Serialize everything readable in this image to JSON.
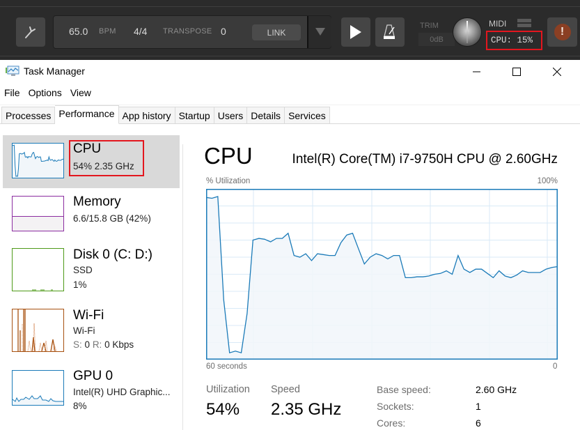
{
  "daw_toolbar": {
    "tempo_value": "65.0",
    "tempo_unit": "BPM",
    "time_signature": "4/4",
    "transpose_label": "TRANSPOSE",
    "transpose_value": "0",
    "link_label": "LINK",
    "trim_label": "TRIM",
    "trim_value": "0dB",
    "midi_label": "MIDI",
    "cpu_readout": "CPU:  15%",
    "icons": [
      "wrench-icon",
      "dropdown-arrow-icon",
      "play-icon",
      "metronome-icon",
      "knob-icon",
      "alert-icon"
    ],
    "highlight_color": "#e3161e"
  },
  "window": {
    "title": "Task Manager",
    "controls": {
      "minimize": "—",
      "maximize": "☐",
      "close": "✕"
    }
  },
  "menu": [
    "File",
    "Options",
    "View"
  ],
  "tabs": [
    {
      "label": "Processes",
      "active": false
    },
    {
      "label": "Performance",
      "active": true
    },
    {
      "label": "App history",
      "active": false
    },
    {
      "label": "Startup",
      "active": false
    },
    {
      "label": "Users",
      "active": false
    },
    {
      "label": "Details",
      "active": false
    },
    {
      "label": "Services",
      "active": false
    }
  ],
  "sidebar": {
    "items": [
      {
        "name": "CPU",
        "line1": "54%  2.35 GHz",
        "line2": "",
        "color": "#1a7ab8",
        "selected": true
      },
      {
        "name": "Memory",
        "line1": "6.6/15.8 GB (42%)",
        "line2": "",
        "color": "#8b2ca0",
        "selected": false
      },
      {
        "name": "Disk 0 (C: D:)",
        "line1": "SSD",
        "line2": "1%",
        "color": "#4e9a18",
        "selected": false
      },
      {
        "name": "Wi-Fi",
        "line1": "Wi-Fi",
        "line2_s": "S:",
        "line2_sv": "0",
        "line2_r": "R:",
        "line2_rv": "0 Kbps",
        "color": "#a7500f",
        "selected": false
      },
      {
        "name": "GPU 0",
        "line1": "Intel(R) UHD Graphic...",
        "line2": "8%",
        "color": "#1a7ab8",
        "selected": false
      }
    ],
    "memory_used_fraction": 0.42
  },
  "main": {
    "title": "CPU",
    "model": "Intel(R) Core(TM) i7-9750H CPU @ 2.60GHz",
    "y_label": "% Utilization",
    "y_max_label": "100%",
    "x_left_label": "60 seconds",
    "x_right_label": "0",
    "stats": {
      "utilization_label": "Utilization",
      "utilization_value": "54%",
      "speed_label": "Speed",
      "speed_value": "2.35 GHz"
    },
    "specs": [
      {
        "key": "Base speed:",
        "value": "2.60 GHz"
      },
      {
        "key": "Sockets:",
        "value": "1"
      },
      {
        "key": "Cores:",
        "value": "6"
      }
    ]
  },
  "chart_data": {
    "type": "area",
    "title": "CPU",
    "xlabel": "60 seconds",
    "ylabel": "% Utilization",
    "xlim": [
      60,
      0
    ],
    "ylim": [
      0,
      100
    ],
    "grid": true,
    "line_color": "#1a7ab8",
    "fill_color": "#f1f6fa",
    "x": [
      60,
      59,
      58,
      57,
      56,
      55,
      54,
      53,
      52,
      51,
      50,
      49,
      48,
      47,
      46,
      45,
      44,
      43,
      42,
      41,
      40,
      39,
      38,
      37,
      36,
      35,
      34,
      33,
      32,
      31,
      30,
      29,
      28,
      27,
      26,
      25,
      24,
      23,
      22,
      21,
      20,
      19,
      18,
      17,
      16,
      15,
      14,
      13,
      12,
      11,
      10,
      9,
      8,
      7,
      6,
      5,
      4,
      3,
      2,
      1,
      0
    ],
    "series": [
      {
        "name": "CPU utilization",
        "values": [
          95,
          94.5,
          95.5,
          35,
          4,
          5,
          4,
          27,
          70,
          71,
          70.5,
          69,
          71,
          71,
          74,
          61,
          60,
          62,
          58,
          62,
          61.5,
          61,
          61,
          68.5,
          73,
          74,
          65,
          56,
          60,
          62,
          61,
          59,
          61,
          61,
          48,
          48,
          48.5,
          48.5,
          49,
          50,
          50.5,
          52,
          50,
          61,
          53,
          51,
          53,
          53,
          50.5,
          48,
          52,
          49,
          48,
          49.5,
          52,
          51,
          51,
          51,
          53,
          54,
          54.5
        ]
      }
    ]
  }
}
